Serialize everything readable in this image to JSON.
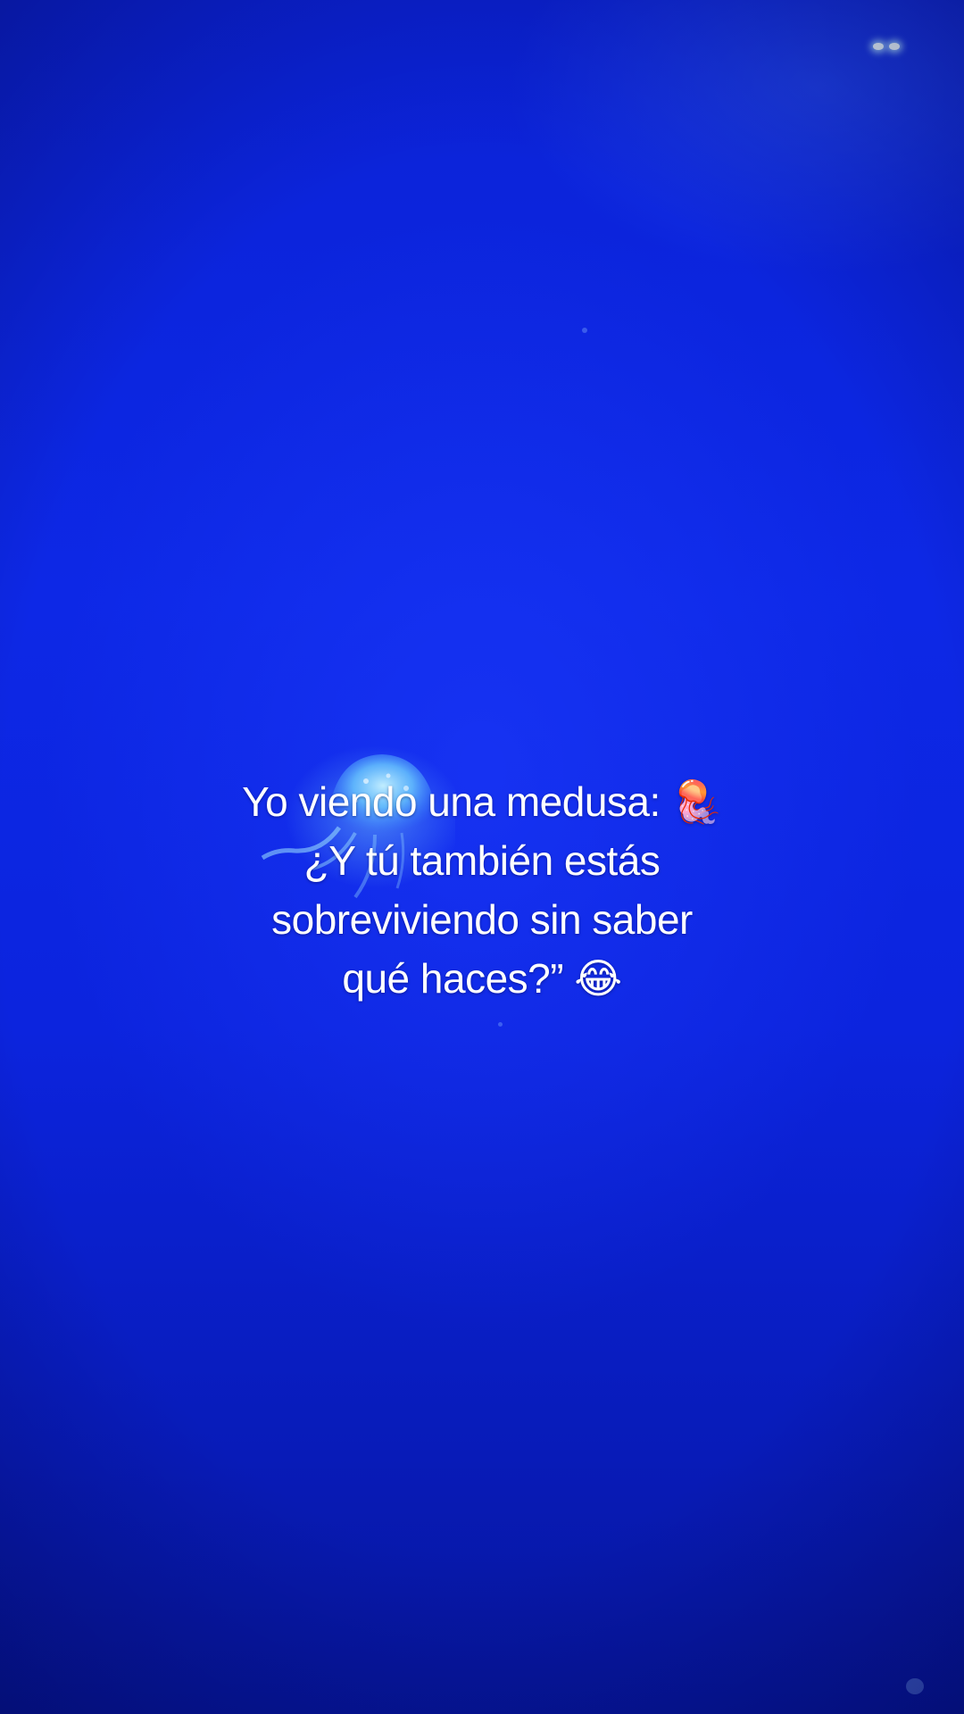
{
  "caption": {
    "lines": [
      "Yo viendo una medusa: 🪼",
      "¿Y tú también estás",
      "sobreviviendo sin saber",
      "qué haces?” 😂"
    ]
  },
  "background": {
    "water_color": "#0b22d6",
    "glow_color": "#7fd8ff"
  }
}
